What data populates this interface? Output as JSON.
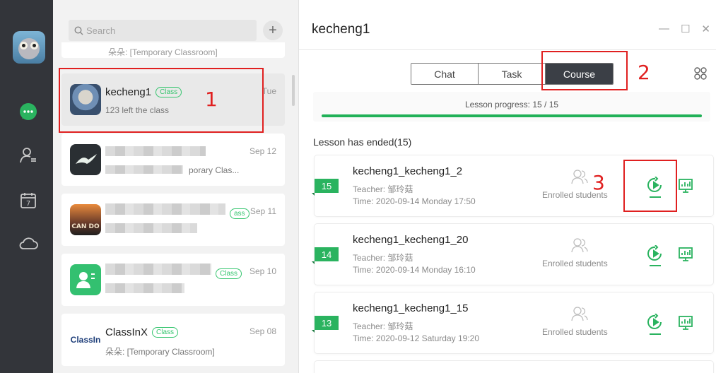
{
  "rail": {
    "icons": [
      "avatar",
      "chat-icon",
      "contacts-icon",
      "calendar-icon",
      "cloud-icon"
    ],
    "calendar_day": "7",
    "accent": "#2ab35f"
  },
  "search": {
    "placeholder": "Search"
  },
  "list": {
    "partial_top_text": "朵朵: [Temporary Classroom]",
    "items": [
      {
        "name": "kecheng1",
        "tag": "Class",
        "sub": "123 left the class",
        "date": "Tue"
      },
      {
        "name": "",
        "tag": "",
        "sub": "porary Clas...",
        "date": "Sep 12"
      },
      {
        "name": "",
        "tag": "ass",
        "sub": "",
        "date": "Sep 11"
      },
      {
        "name": "",
        "tag": "Class",
        "sub": "",
        "date": "Sep 10"
      },
      {
        "name": "ClassInX",
        "tag": "Class",
        "sub": "朵朵: [Temporary Classroom]",
        "date": "Sep 08",
        "logo": "ClassIn"
      }
    ]
  },
  "main": {
    "title": "kecheng1",
    "window_controls": [
      "—",
      "☐",
      "✕"
    ],
    "tabs": [
      {
        "label": "Chat",
        "active": false
      },
      {
        "label": "Task",
        "active": false
      },
      {
        "label": "Course",
        "active": true
      }
    ],
    "progress": {
      "text": "Lesson progress: 15 / 15",
      "completed": 15,
      "total": 15
    },
    "section_title": "Lesson has ended(15)",
    "lessons": [
      {
        "num": "15",
        "name": "kecheng1_kecheng1_2",
        "teacher": "Teacher: 邹玲菇",
        "time": "Time: 2020-09-14 Monday 17:50",
        "enrolled": "Enrolled students"
      },
      {
        "num": "14",
        "name": "kecheng1_kecheng1_20",
        "teacher": "Teacher: 邹玲菇",
        "time": "Time: 2020-09-14 Monday 16:10",
        "enrolled": "Enrolled students"
      },
      {
        "num": "13",
        "name": "kecheng1_kecheng1_15",
        "teacher": "Teacher: 邹玲菇",
        "time": "Time: 2020-09-12 Saturday 19:20",
        "enrolled": "Enrolled students"
      }
    ]
  },
  "annotations": {
    "one": "1",
    "two": "2",
    "three": "3",
    "color": "#e02020"
  }
}
